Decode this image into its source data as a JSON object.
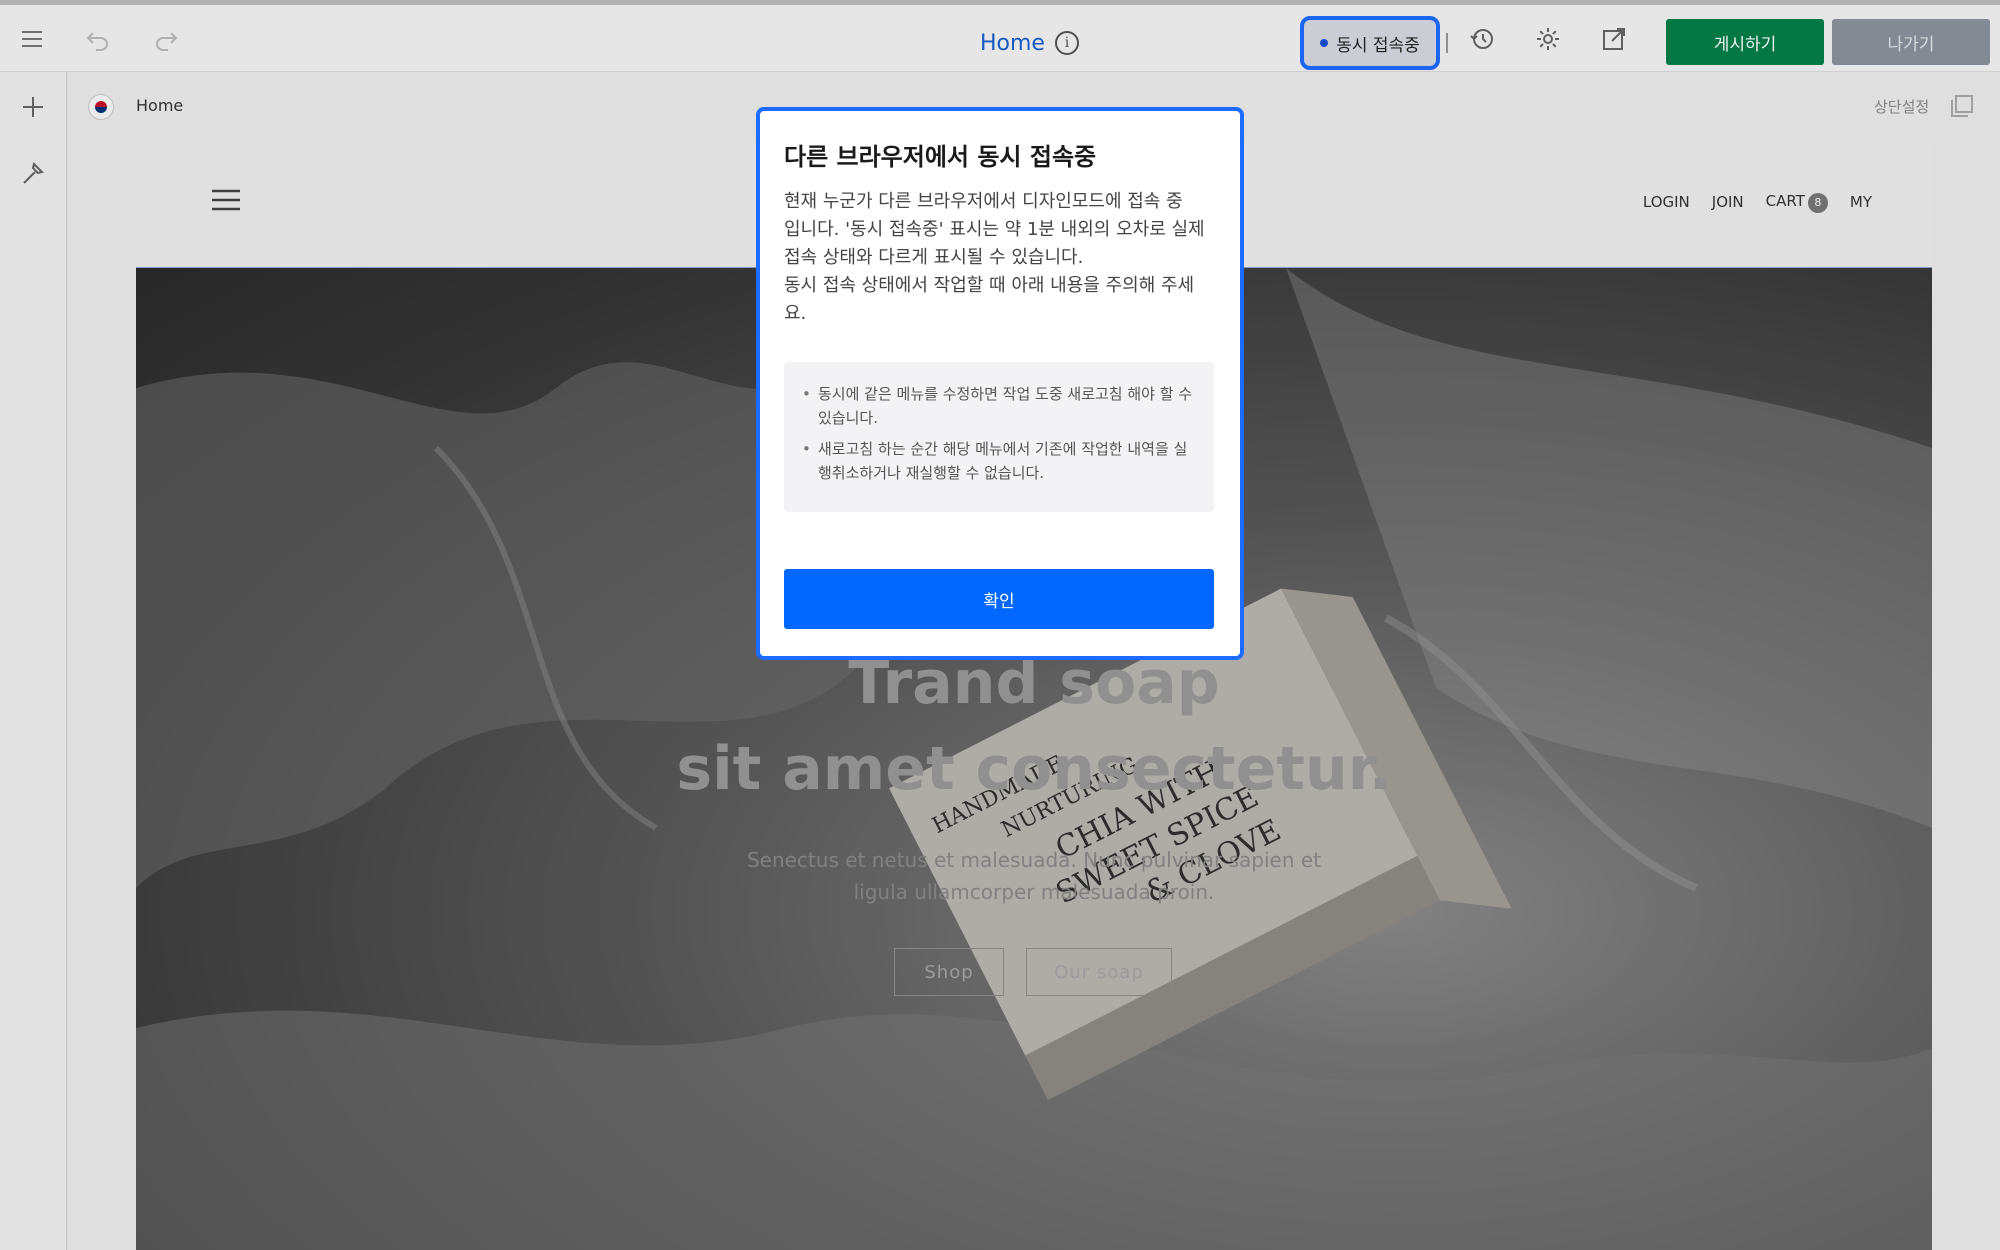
{
  "toolbar": {
    "page_title": "Home",
    "info_icon": "i",
    "concurrent_badge": "동시 접속중",
    "publish_label": "게시하기",
    "exit_label": "나가기"
  },
  "canvas": {
    "page_name": "Home",
    "header_setting": "상단설정"
  },
  "site": {
    "nav": [
      "LOGIN",
      "JOIN",
      "CART",
      "MY"
    ],
    "cart_count": "8",
    "hero_title_line1": "Trand soap",
    "hero_title_line2": "sit amet consectetur.",
    "hero_sub_line1": "Senectus et netus et malesuada. Nunc pulvinar sapien et",
    "hero_sub_line2": "ligula ullamcorper malesuada proin.",
    "btn_shop": "Shop",
    "btn_our_soap": "Our soap",
    "box_text": [
      "HANDMADE",
      "NURTURING",
      "CHIA WITH",
      "SWEET SPICE",
      "& CLOVE"
    ]
  },
  "modal": {
    "title": "다른 브라우저에서 동시 접속중",
    "body_lines": [
      "현재 누군가 다른 브라우저에서 디자인모드에 접속 중",
      "입니다. '동시 접속중' 표시는 약 1분 내외의 오차로 실제",
      "접속 상태와 다르게 표시될 수 있습니다.",
      "동시 접속 상태에서 작업할 때 아래 내용을 주의해 주세",
      "요."
    ],
    "notices": [
      "동시에 같은 메뉴를 수정하면 작업 도중 새로고침 해야 할 수 있습니다.",
      "새로고침 하는 순간 해당 메뉴에서 기존에 작업한 내역을 실행취소하거나 재실행할 수 없습니다."
    ],
    "confirm_label": "확인"
  },
  "colors": {
    "accent": "#1e6cff",
    "publish": "#04804a",
    "exit": "#8c939e",
    "confirm": "#0068ff"
  }
}
